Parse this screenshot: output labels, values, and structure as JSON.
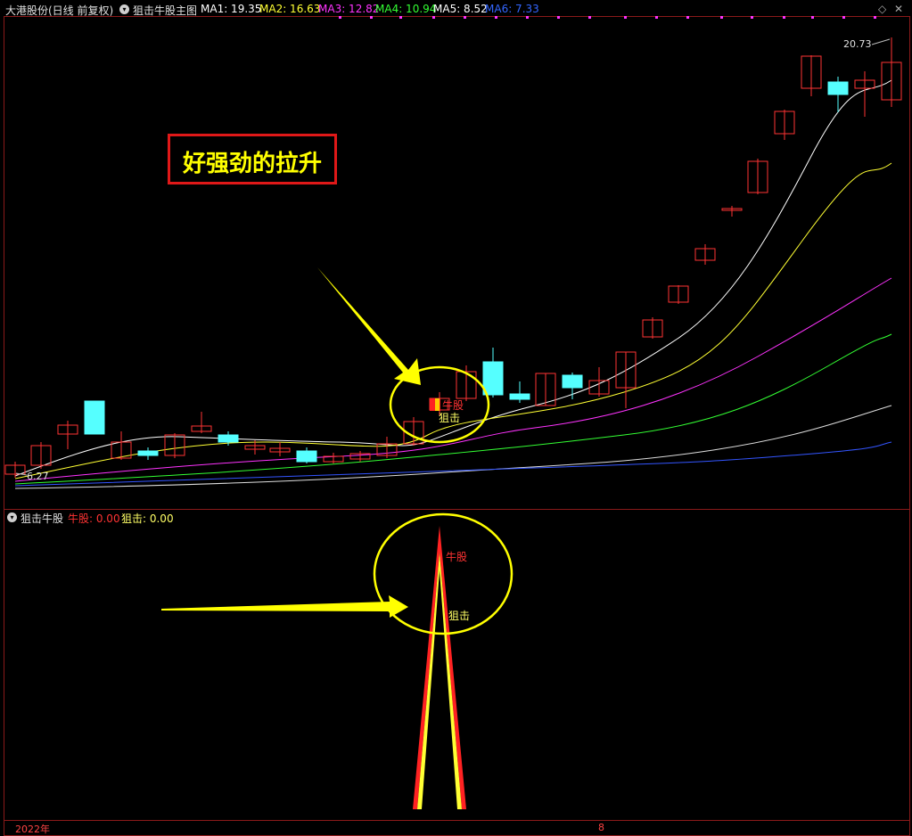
{
  "header": {
    "stock": "大港股份(日线 前复权)",
    "indicator_main": "狙击牛股主图",
    "ma": [
      {
        "label": "MA1: 19.35",
        "color": "#ffffff"
      },
      {
        "label": "MA2: 16.63",
        "color": "#ffff33"
      },
      {
        "label": "MA3: 12.82",
        "color": "#ff33ff"
      },
      {
        "label": "MA4: 10.94",
        "color": "#33ff33"
      },
      {
        "label": "MA5: 8.52",
        "color": "#ffffff"
      },
      {
        "label": "MA6: 7.33",
        "color": "#3366ff"
      }
    ]
  },
  "main_chart": {
    "max_price_label": "20.73",
    "min_price_label": "6.27",
    "annotation_box": "好强劲的拉升",
    "signal_label_niu": "牛股",
    "signal_label_ju": "狙击"
  },
  "sub_chart": {
    "title": "狙击牛股",
    "niu_label": "牛股: 0.00",
    "ju_label": "狙击: 0.00",
    "peak_label_niu": "牛股",
    "peak_label_ju": "狙击"
  },
  "footer": {
    "year": "2022年",
    "month": "8"
  },
  "colors": {
    "up": "#ff3333",
    "down": "#55ffff",
    "frame": "#8b1a1a",
    "annotation_yellow": "#ffff00"
  }
}
